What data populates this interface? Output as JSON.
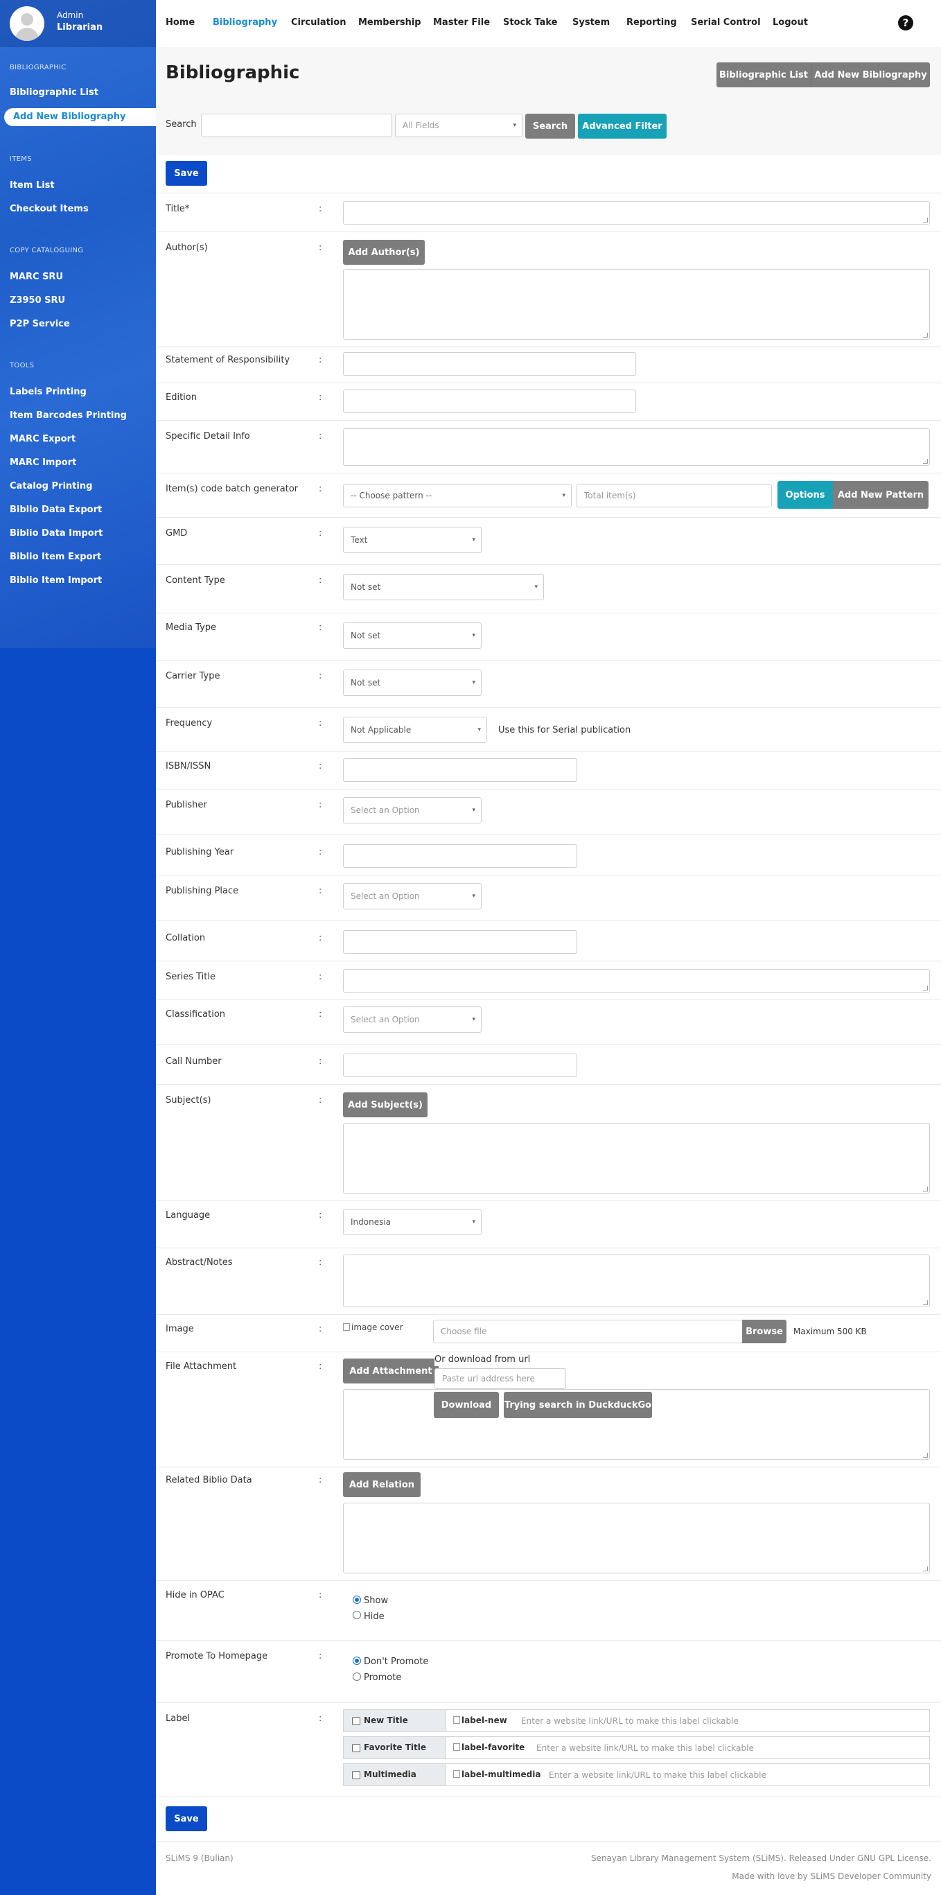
{
  "user": {
    "role": "Admin",
    "name": "Librarian"
  },
  "sidebar": {
    "sections": [
      {
        "title": "BIBLIOGRAPHIC",
        "items": [
          "Bibliographic List",
          "Add New Bibliography"
        ]
      },
      {
        "title": "ITEMS",
        "items": [
          "Item List",
          "Checkout Items"
        ]
      },
      {
        "title": "COPY CATALOGUING",
        "items": [
          "MARC SRU",
          "Z3950 SRU",
          "P2P Service"
        ]
      },
      {
        "title": "TOOLS",
        "items": [
          "Labels Printing",
          "Item Barcodes Printing",
          "MARC Export",
          "MARC Import",
          "Catalog Printing",
          "Biblio Data Export",
          "Biblio Data Import",
          "Biblio Item Export",
          "Biblio Item Import"
        ]
      }
    ],
    "active_item": "Add New Bibliography"
  },
  "nav": {
    "items": [
      "Home",
      "Bibliography",
      "Circulation",
      "Membership",
      "Master File",
      "Stock Take",
      "System",
      "Reporting",
      "Serial Control",
      "Logout"
    ],
    "active": "Bibliography",
    "help_icon": "question-circle-icon"
  },
  "header": {
    "title": "Bibliographic",
    "buttons": [
      "Bibliographic List",
      "Add New Bibliography"
    ],
    "search_label": "Search",
    "search_value": "",
    "field_select": "All Fields",
    "search_button": "Search",
    "advanced_button": "Advanced Filter"
  },
  "form": {
    "save_button": "Save",
    "fields": {
      "title": "Title*",
      "authors": "Author(s)",
      "add_author": "Add Author(s)",
      "statement": "Statement of Responsibility",
      "edition": "Edition",
      "specific_detail": "Specific Detail Info",
      "batch_generator": "Item(s) code batch generator",
      "pattern_select": "-- Choose pattern --",
      "total_items_placeholder": "Total item(s)",
      "options_button": "Options",
      "add_pattern_button": "Add New Pattern",
      "gmd": "GMD",
      "gmd_value": "Text",
      "content_type": "Content Type",
      "content_type_value": "Not set",
      "media_type": "Media Type",
      "media_type_value": "Not set",
      "carrier_type": "Carrier Type",
      "carrier_type_value": "Not set",
      "frequency": "Frequency",
      "frequency_value": "Not Applicable",
      "frequency_hint": "Use this for Serial publication",
      "isbn": "ISBN/ISSN",
      "publisher": "Publisher",
      "publisher_placeholder": "Select an Option",
      "publishing_year": "Publishing Year",
      "publishing_place": "Publishing Place",
      "publishing_place_placeholder": "Select an Option",
      "collation": "Collation",
      "series_title": "Series Title",
      "classification": "Classification",
      "classification_placeholder": "Select an Option",
      "call_number": "Call Number",
      "subjects": "Subject(s)",
      "add_subject": "Add Subject(s)",
      "language": "Language",
      "language_value": "Indonesia",
      "abstract": "Abstract/Notes",
      "image": "Image",
      "image_alt": "image cover",
      "choose_file": "Choose file",
      "browse_button": "Browse",
      "max_size": "Maximum 500 KB",
      "file_attachment": "File Attachment",
      "add_attachment": "Add Attachment",
      "download_from_url": "Or download from url",
      "url_placeholder": "Paste url address here",
      "download_button": "Download",
      "duckduckgo_button": "Trying search in DuckduckGo",
      "related_biblio": "Related Biblio Data",
      "add_relation": "Add Relation",
      "hide_opac": "Hide in OPAC",
      "show_option": "Show",
      "hide_option": "Hide",
      "promote": "Promote To Homepage",
      "dont_promote_option": "Don't Promote",
      "promote_option": "Promote",
      "label": "Label"
    },
    "labels": [
      {
        "name": "New Title",
        "image_alt": "label-new",
        "placeholder": "Enter a website link/URL to make this label clickable"
      },
      {
        "name": "Favorite Title",
        "image_alt": "label-favorite",
        "placeholder": "Enter a website link/URL to make this label clickable"
      },
      {
        "name": "Multimedia",
        "image_alt": "label-multimedia",
        "placeholder": "Enter a website link/URL to make this label clickable"
      }
    ]
  },
  "footer": {
    "version": "SLiMS 9 (Bulian)",
    "license": "Senayan Library Management System (SLiMS). Released Under GNU GPL License.",
    "credit": "Made with love by SLiMS Developer Community"
  }
}
